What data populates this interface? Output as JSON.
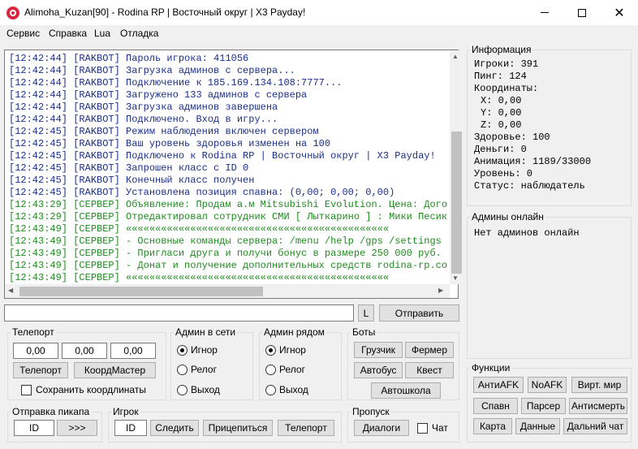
{
  "window": {
    "title": "Alimoha_Kuzan[90] - Rodina RP | Восточный округ | X3 Payday!",
    "app_icon": "rodina-logo-icon"
  },
  "menu": [
    "Сервис",
    "Справка",
    "Lua",
    "Отладка"
  ],
  "log": {
    "lines": [
      {
        "text": "[12:42:44] [RAKBOT] Пароль игрока: 411056",
        "color": "blue"
      },
      {
        "text": "[12:42:44] [RAKBOT] Загрузка админов с сервера...",
        "color": "blue"
      },
      {
        "text": "[12:42:44] [RAKBOT] Подключение к 185.169.134.108:7777...",
        "color": "blue"
      },
      {
        "text": "[12:42:44] [RAKBOT] Загружено 133 админов с сервера",
        "color": "blue"
      },
      {
        "text": "[12:42:44] [RAKBOT] Загрузка админов завершена",
        "color": "blue"
      },
      {
        "text": "[12:42:44] [RAKBOT] Подключено. Вход в игру...",
        "color": "blue"
      },
      {
        "text": "[12:42:45] [RAKBOT] Режим наблюдения включен сервером",
        "color": "blue"
      },
      {
        "text": "[12:42:45] [RAKBOT] Ваш уровень здоровья изменен на 100",
        "color": "blue"
      },
      {
        "text": "[12:42:45] [RAKBOT] Подключено к Rodina RP | Восточный округ | X3 Payday!",
        "color": "blue"
      },
      {
        "text": "[12:42:45] [RAKBOT] Запрошен класс с ID 0",
        "color": "blue"
      },
      {
        "text": "[12:42:45] [RAKBOT] Конечный класс получен",
        "color": "blue"
      },
      {
        "text": "[12:42:45] [RAKBOT] Установлена позиция спавна: (0,00; 0,00; 0,00)",
        "color": "blue"
      },
      {
        "text": "[12:43:29] [СЕРВЕР] Объявление: Продам а.м Mitsubishi Evolution. Цена: Догово",
        "color": "green"
      },
      {
        "text": "[12:43:29] [СЕРВЕР] Отредактировал сотрудник СМИ [ Лыткарино ] : Мики Песик[7",
        "color": "green"
      },
      {
        "text": "[12:43:49] [СЕРВЕР] «««««««««««««««««««««««««««««««««««««««««««««",
        "color": "green"
      },
      {
        "text": "[12:43:49] [СЕРВЕР] - Основные команды сервера: /menu /help /gps /settings",
        "color": "green"
      },
      {
        "text": "[12:43:49] [СЕРВЕР] - Пригласи друга и получи бонус в размере 250 000 руб.",
        "color": "green"
      },
      {
        "text": "[12:43:49] [СЕРВЕР] - Донат и получение дополнительных средств rodina-rp.com/",
        "color": "green"
      },
      {
        "text": "[12:43:49] [СЕРВЕР] «««««««««««««««««««««««««««««««««««««««««««««",
        "color": "green"
      }
    ]
  },
  "command": {
    "value": "",
    "l_label": "L",
    "send_label": "Отправить"
  },
  "teleport": {
    "title": "Телепорт",
    "x": "0,00",
    "y": "0,00",
    "z": "0,00",
    "teleport_label": "Телепорт",
    "coord_master_label": "КоордМастер",
    "save_coords_label": "Сохранить коордлинаты"
  },
  "admin_online_group": {
    "title": "Админ в сети",
    "options": [
      "Игнор",
      "Релог",
      "Выход"
    ],
    "selected": 0
  },
  "admin_near_group": {
    "title": "Админ рядом",
    "options": [
      "Игнор",
      "Релог",
      "Выход"
    ],
    "selected": 0
  },
  "bots": {
    "title": "Боты",
    "loader": "Грузчик",
    "farmer": "Фермер",
    "bus": "Автобус",
    "quest": "Квест",
    "driving_school": "Автошкола"
  },
  "pickup": {
    "title": "Отправка пикапа",
    "id_value": "ID",
    "send_label": ">>>"
  },
  "player": {
    "title": "Игрок",
    "id_value": "ID",
    "follow_label": "Следить",
    "attach_label": "Прицепиться",
    "teleport_label": "Телепорт"
  },
  "pass": {
    "title": "Пропуск",
    "dialogs_label": "Диалоги",
    "chat_label": "Чат"
  },
  "info": {
    "title": "Информация",
    "players": "Игроки: 391",
    "ping": "Пинг: 124",
    "coords_label": "Координаты:",
    "x": "X: 0,00",
    "y": "Y: 0,00",
    "z": "Z: 0,00",
    "health": "Здоровье: 100",
    "money": "Деньги: 0",
    "animation": "Анимация: 1189/33000",
    "level": "Уровень: 0",
    "status": "Статус: наблюдатель"
  },
  "admins_online": {
    "title": "Админы онлайн",
    "text": "Нет админов онлайн"
  },
  "functions": {
    "title": "Функции",
    "buttons": [
      "АнтиAFK",
      "NoAFK",
      "Вирт. мир",
      "Спавн",
      "Парсер",
      "Антисмерть",
      "Карта",
      "Данные",
      "Дальний чат"
    ]
  },
  "colors": {
    "log_blue": "#1c2f8c",
    "log_green": "#1e8c1e",
    "button_bg": "#e1e1e1"
  }
}
